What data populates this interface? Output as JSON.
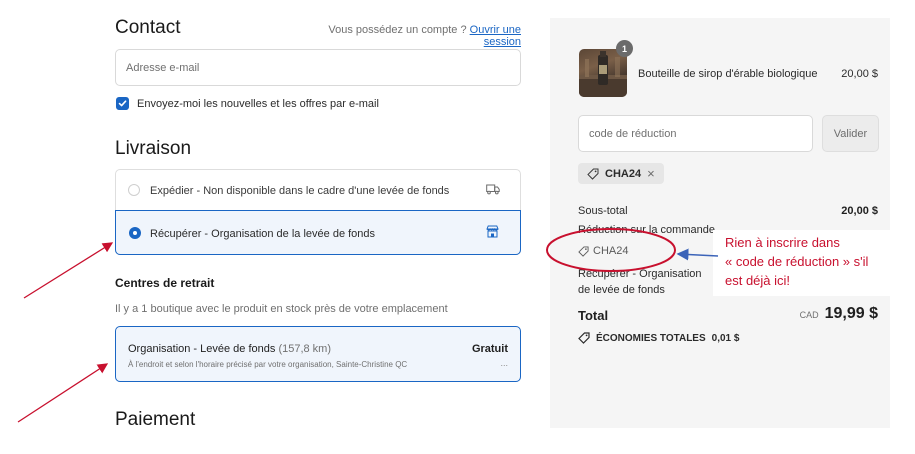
{
  "contact": {
    "title": "Contact",
    "account_prompt": "Vous possédez un compte ?",
    "login_link": "Ouvrir une session",
    "email_placeholder": "Adresse e-mail",
    "newsletter_label": "Envoyez-moi les nouvelles et les offres par e-mail"
  },
  "delivery": {
    "title": "Livraison",
    "ship_option": "Expédier - Non disponible dans le cadre d'une levée de fonds",
    "pickup_option": "Récupérer - Organisation de la levée de fonds"
  },
  "pickup_centers": {
    "title": "Centres de retrait",
    "info": "Il y a 1 boutique avec le produit en stock près de votre emplacement",
    "location_name": "Organisation - Levée de fonds",
    "location_distance": "(157,8 km)",
    "location_detail": "À l'endroit et selon l'horaire précisé par votre organisation, Sainte-Christine QC",
    "location_price": "Gratuit",
    "location_more": "..."
  },
  "payment": {
    "title": "Paiement"
  },
  "summary": {
    "item_qty": "1",
    "item_name": "Bouteille de sirop d'érable biologique",
    "item_price": "20,00 $",
    "discount_placeholder": "code de réduction",
    "apply_label": "Valider",
    "applied_code": "CHA24",
    "subtotal_label": "Sous-total",
    "subtotal_value": "20,00 $",
    "order_discount_label": "Réduction sur la commande",
    "order_discount_code": "CHA24",
    "pickup_label": "Récupérer - Organisation de levée de fonds",
    "total_label": "Total",
    "currency": "CAD",
    "total_value": "19,99 $",
    "savings_label": "ÉCONOMIES TOTALES",
    "savings_value": "0,01 $"
  },
  "annotation": {
    "line1": "Rien à inscrire dans",
    "line2": "« code de réduction » s'il",
    "line3": "est déjà ici!"
  },
  "colors": {
    "accent": "#1a66c4",
    "annotation": "#c8102e",
    "summary_bg": "#f5f5f5"
  }
}
